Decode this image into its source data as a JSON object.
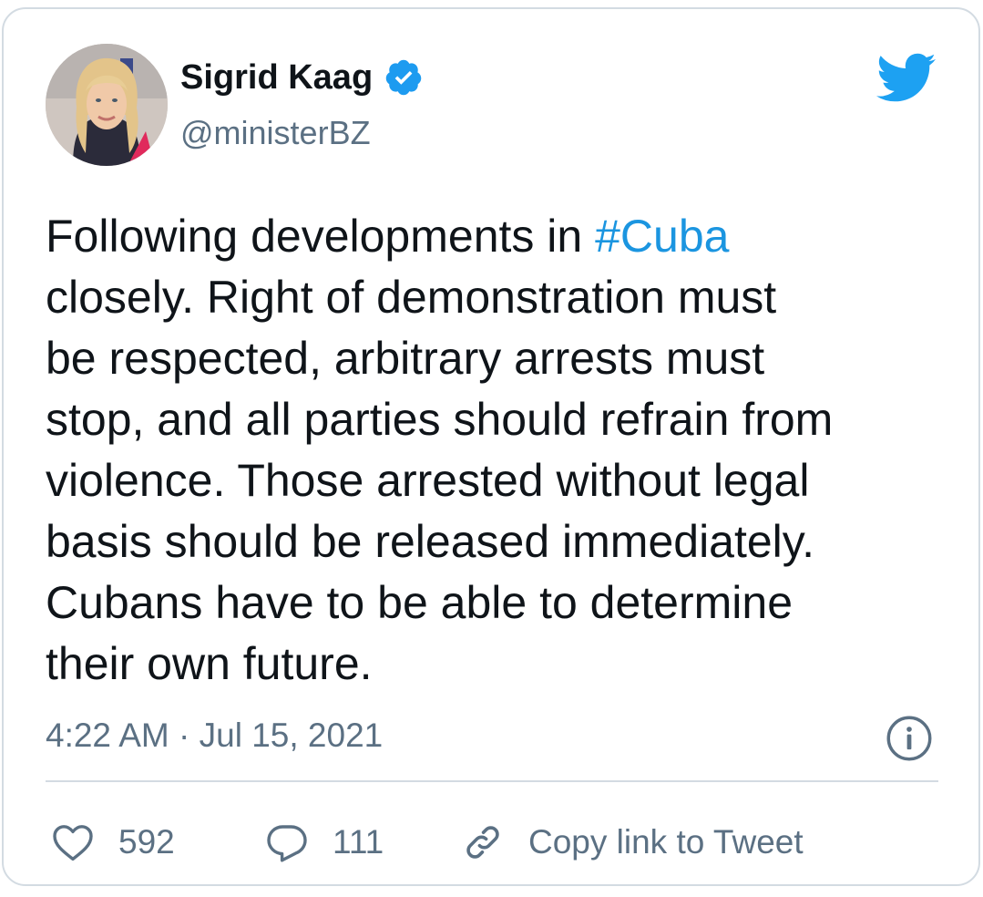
{
  "author": {
    "display_name": "Sigrid Kaag",
    "handle": "@ministerBZ",
    "verified": true,
    "verified_color": "#1d9bf0"
  },
  "tweet": {
    "lines": [
      {
        "before": "Following developments in ",
        "hashtag": "#Cuba"
      },
      {
        "text": "closely. Right of demonstration must"
      },
      {
        "text": "be respected, arbitrary arrests must"
      },
      {
        "text": "stop, and all parties should refrain from"
      },
      {
        "text": "violence. Those arrested without legal"
      },
      {
        "text": "basis should be released immediately."
      },
      {
        "text": "Cubans have to be able to determine"
      },
      {
        "text": "their own future."
      }
    ],
    "timestamp": "4:22 AM · Jul 15, 2021"
  },
  "actions": {
    "likes": "592",
    "replies": "111",
    "copy_link_label": "Copy link to Tweet"
  },
  "icons": {
    "brand": "twitter-bird-icon",
    "info": "info-icon",
    "like": "heart-icon",
    "reply": "reply-bubble-icon",
    "link": "link-icon"
  },
  "colors": {
    "text": "#0f1419",
    "secondary": "#5b7083",
    "link": "#1b95e0",
    "twitter_blue": "#1da1f2",
    "border": "#d3dbe2"
  }
}
